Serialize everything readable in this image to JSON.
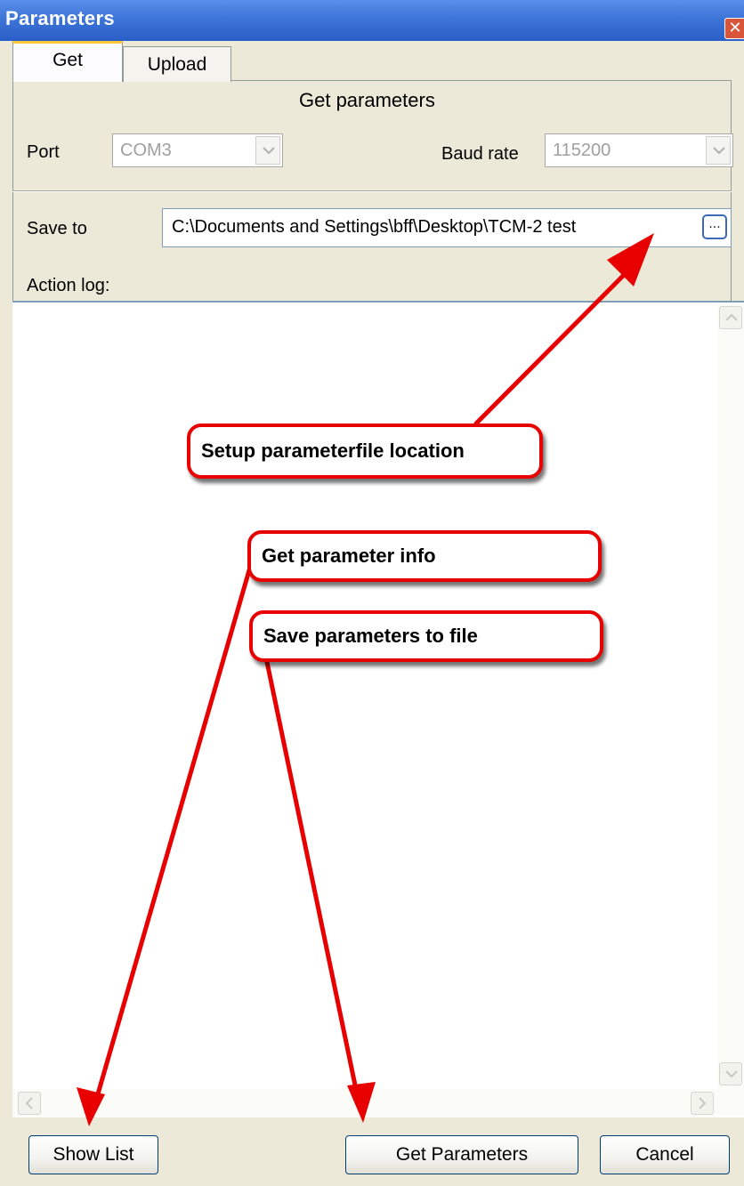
{
  "window": {
    "title": "Parameters",
    "close_glyph": "✕"
  },
  "tabs": [
    {
      "label": "Get"
    },
    {
      "label": "Upload"
    }
  ],
  "get_panel": {
    "heading": "Get parameters",
    "port": {
      "label": "Port",
      "value": "COM3"
    },
    "baud_rate": {
      "label": "Baud rate",
      "value": "115200"
    },
    "save_to": {
      "label": "Save to",
      "value": "C:\\Documents and Settings\\bff\\Desktop\\TCM-2 test",
      "browse_label": "..."
    },
    "action_log_label": "Action log:"
  },
  "buttons": {
    "show_list": "Show List",
    "get_parameters": "Get Parameters",
    "cancel": "Cancel"
  },
  "annotations": {
    "setup_location": "Setup parameterfile location",
    "get_info": "Get parameter info",
    "save_to_file": "Save parameters to file"
  },
  "colors": {
    "annotation": "#e80000",
    "titlebar": "#3d74d8",
    "dialog_bg": "#ece9d8"
  },
  "icons": [
    "close-icon",
    "chevron-down-icon",
    "browse-icon",
    "scroll-up-icon",
    "scroll-down-icon",
    "scroll-left-icon",
    "scroll-right-icon"
  ]
}
